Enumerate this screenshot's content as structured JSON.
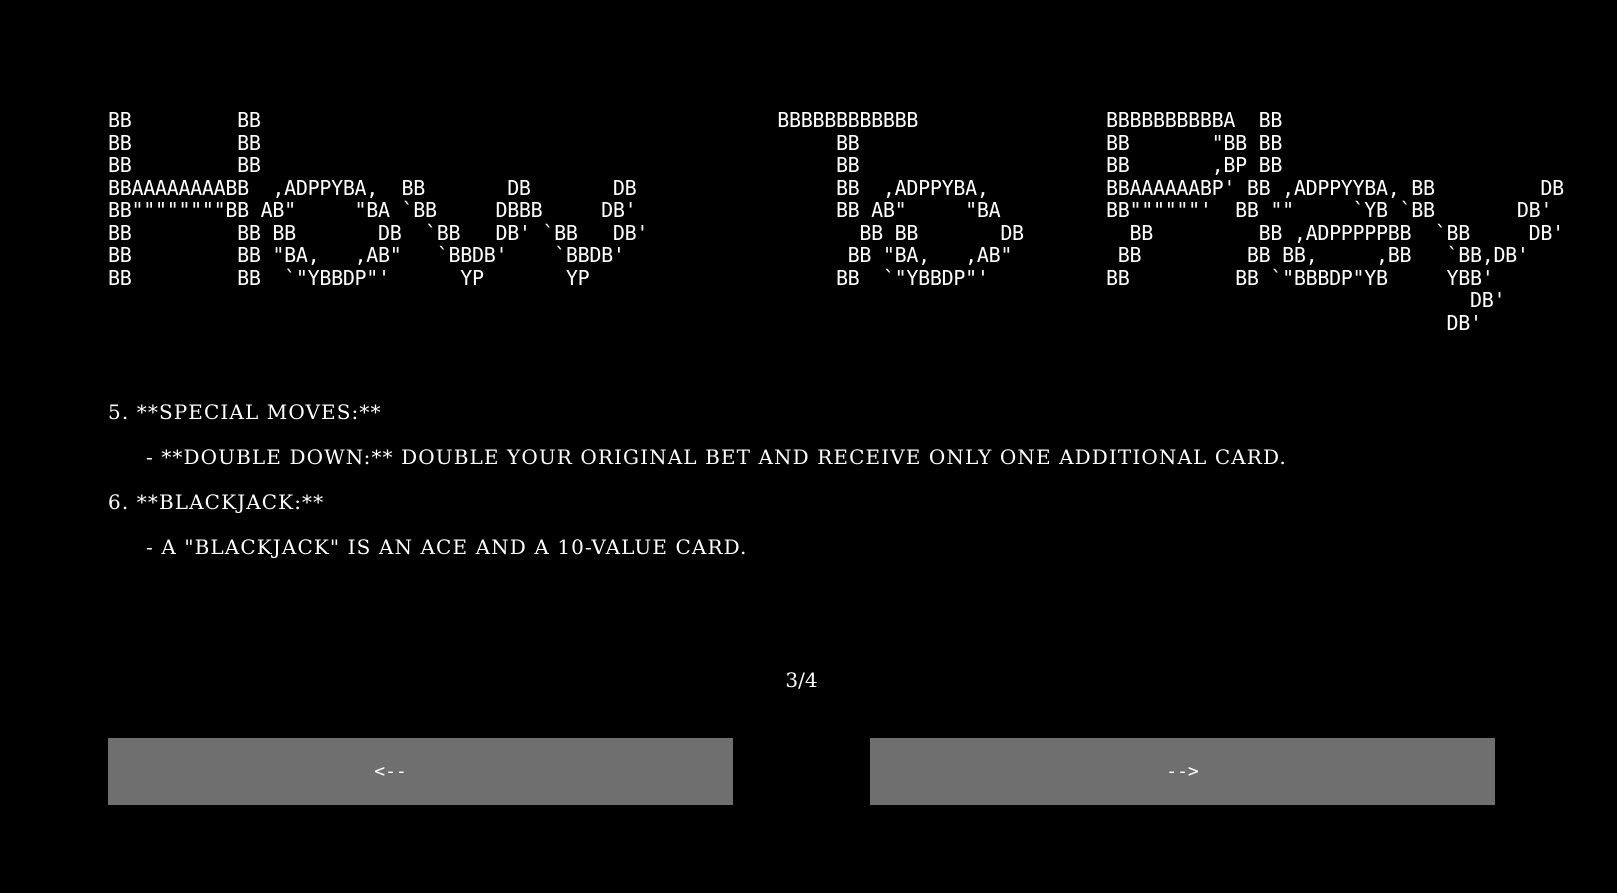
{
  "banner": {
    "art": "BB         BB                                            BBBBBBBBBBBB                BBBBBBBBBBA  BB\nBB         BB                                                 BB                     BB       \"BB BB\nBB         BB                                                 BB                     BB       ,BP BB\nBBAAAAAAAABB  ,ADPPYBA,  BB       DB       DB                 BB  ,ADPPYBA,          BBAAAAAABP' BB ,ADPPYYBA, BB         DB\nBB\"\"\"\"\"\"\"\"BB AB\"     \"BA `BB     DBBB     DB'                 BB AB\"     \"BA         BB\"\"\"\"\"\"'  BB \"\"     `YB `BB       DB'\nBB         BB BB       DB  `BB   DB' `BB   DB'                  BB BB       DB         BB         BB ,ADPPPPPBB  `BB     DB'\nBB         BB \"BA,   ,AB\"   `BBDB'    `BBDB'                   BB \"BA,   ,AB\"         BB         BB BB,     ,BB   `BB,DB'\nBB         BB  `\"YBBDP\"'      YP       YP                     BB  `\"YBBDP\"'          BB         BB `\"BBBDP\"YB     YBB'\n                                                                                                                    DB'\n                                                                                                                  DB'"
  },
  "rules": {
    "item5_heading": "5. **SPECIAL MOVES:**",
    "item5_detail": "- **DOUBLE DOWN:** DOUBLE YOUR ORIGINAL BET AND RECEIVE ONLY ONE ADDITIONAL CARD.",
    "item6_heading": "6. **BLACKJACK:**",
    "item6_detail": "- A \"BLACKJACK\" IS AN ACE AND A 10-VALUE CARD."
  },
  "pagination": {
    "indicator": "3/4",
    "prev_label": "<--",
    "next_label": "-->"
  },
  "colors": {
    "background": "#000000",
    "text": "#ffffff",
    "button": "#6f6f6f"
  }
}
